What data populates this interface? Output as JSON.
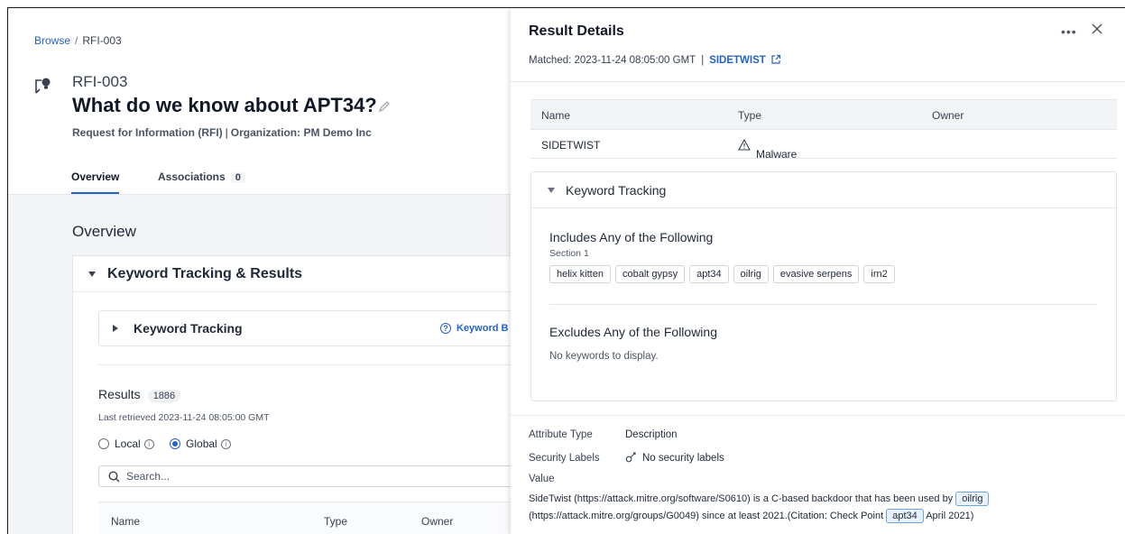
{
  "breadcrumb": {
    "root": "Browse",
    "sep": "/",
    "current": "RFI-003"
  },
  "rfi": {
    "id": "RFI-003",
    "title": "What do we know about APT34?",
    "type": "Request for Information (RFI)",
    "separator": "|",
    "org": "Organization: PM Demo Inc"
  },
  "tabs": [
    {
      "label": "Overview",
      "active": true
    },
    {
      "label": "Associations",
      "count": "0"
    }
  ],
  "overview": {
    "title": "Overview",
    "section_title": "Keyword Tracking & Results",
    "kt_label": "Keyword Tracking",
    "kt_help": "Keyword B",
    "results": {
      "title": "Results",
      "count": "1886",
      "last_retrieved": "Last retrieved 2023-11-24 08:05:00 GMT",
      "radio_local": "Local",
      "radio_global": "Global",
      "selected": "Global",
      "search_placeholder": "Search...",
      "columns": [
        "Name",
        "Type",
        "Owner"
      ]
    }
  },
  "panel": {
    "title": "Result Details",
    "matched": "Matched: 2023-11-24 08:05:00 GMT",
    "matched_sep": "|",
    "entity_link": "SIDETWIST",
    "table": {
      "columns": [
        "Name",
        "Type",
        "Owner"
      ],
      "row": {
        "name": "SIDETWIST",
        "type": "Malware",
        "owner": ""
      }
    },
    "keyword_tracking": {
      "label": "Keyword Tracking",
      "includes_title": "Includes Any of the Following",
      "section": "Section 1",
      "keywords": [
        "helix kitten",
        "cobalt gypsy",
        "apt34",
        "oilrig",
        "evasive serpens",
        "irn2"
      ],
      "excludes_title": "Excludes Any of the Following",
      "excludes_empty": "No keywords to display."
    },
    "attributes": {
      "attr_type_label": "Attribute Type",
      "attr_type_value": "Description",
      "sec_label": "Security Labels",
      "sec_value": "No security labels",
      "value_label": "Value",
      "desc_part1": "SideTwist (https://attack.mitre.org/software/S0610) is a C-based backdoor that has been used by",
      "hl1": "oilrig",
      "desc_part2": "(https://attack.mitre.org/groups/G0049) since at least 2021.(Citation: Check Point",
      "hl2": "apt34",
      "desc_part3": "April 2021)"
    }
  },
  "colors": {
    "accent": "#2563c9",
    "highlight_bg": "#eaf3fd",
    "highlight_border": "#6aa7e8"
  }
}
